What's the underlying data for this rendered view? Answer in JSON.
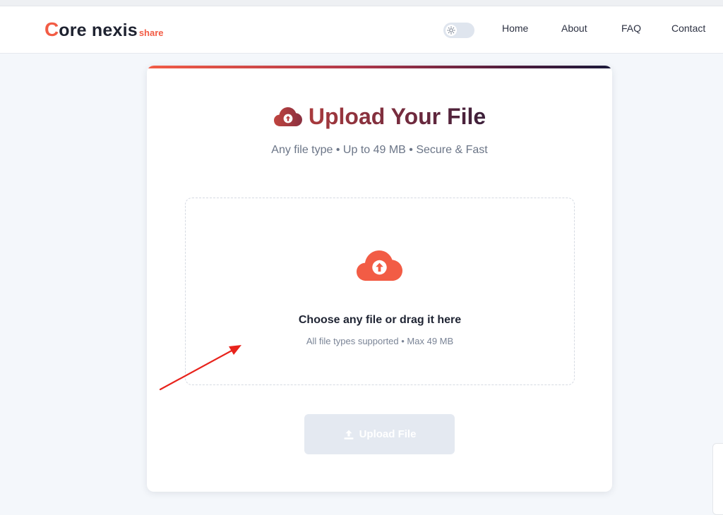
{
  "brand": {
    "first_letter": "C",
    "rest": "ore nexis",
    "suffix": "share"
  },
  "nav": {
    "theme_toggle": "light",
    "links": [
      "Home",
      "About",
      "FAQ",
      "Contact"
    ]
  },
  "upload_card": {
    "title": "Upload Your File",
    "subtitle": "Any file type • Up to 49 MB • Secure & Fast",
    "dropzone": {
      "title": "Choose any file or drag it here",
      "subtitle": "All file types supported • Max 49 MB"
    },
    "button_label": "Upload File"
  },
  "colors": {
    "accent": "#f25c45",
    "title_dark": "#6e2a3e",
    "annotation_arrow": "#e8231c"
  }
}
